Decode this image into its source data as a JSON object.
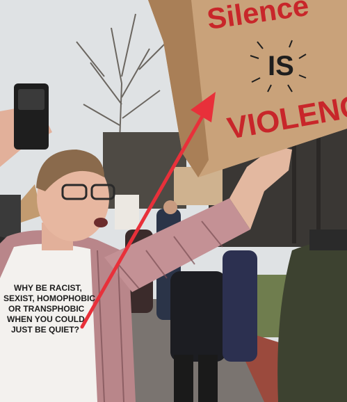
{
  "sign": {
    "line1": "Silence",
    "line2": "IS",
    "line3": "VIOLENCE"
  },
  "shirt": {
    "lines": [
      "WHY BE RACIST,",
      "SEXIST, HOMOPHOBIC,",
      "OR TRANSPHOBIC",
      "WHEN YOU COULD",
      "JUST BE QUIET?"
    ]
  },
  "colors": {
    "sign_text": "#c8262a",
    "arrow": "#e8303a",
    "cardboard": "#c9a27a",
    "sky": "#dfe2e4"
  },
  "icons": {
    "arrow": "red-arrow-annotation",
    "phone": "smartphone"
  }
}
